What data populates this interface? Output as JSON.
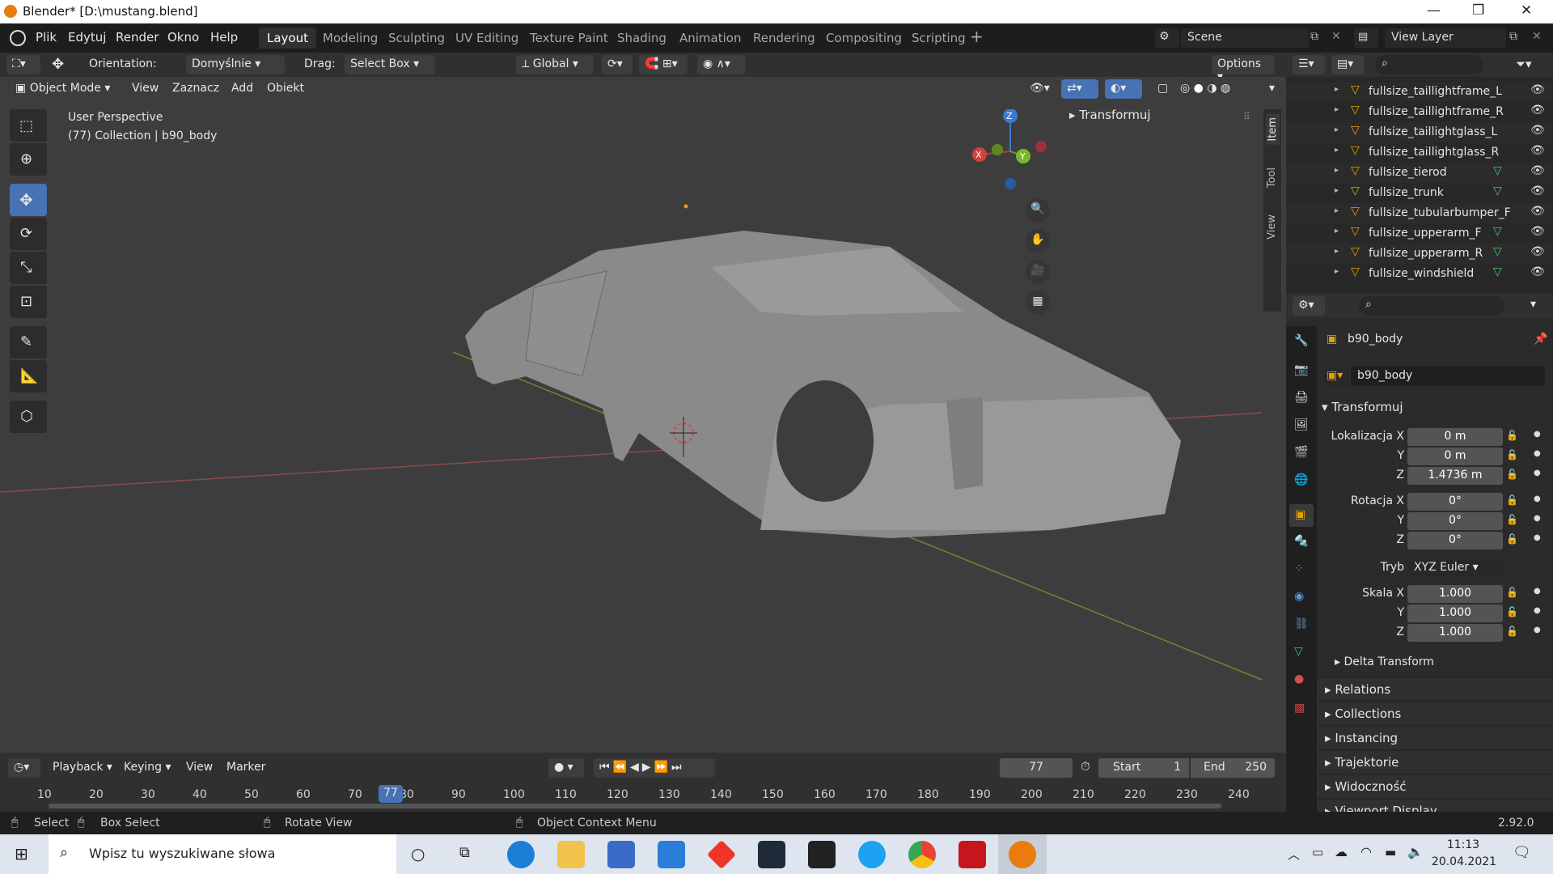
{
  "window": {
    "title": "Blender* [D:\\mustang.blend]"
  },
  "menu": [
    "Plik",
    "Edytuj",
    "Render",
    "Okno",
    "Help"
  ],
  "workspaces": [
    "Layout",
    "Modeling",
    "Sculpting",
    "UV Editing",
    "Texture Paint",
    "Shading",
    "Animation",
    "Rendering",
    "Compositing",
    "Scripting"
  ],
  "active_workspace": "Layout",
  "scene": {
    "label": "Scene",
    "view_layer": "View Layer"
  },
  "toolheader": {
    "orientation_label": "Orientation:",
    "orientation_value": "Domyślnie",
    "drag_label": "Drag:",
    "drag_value": "Select Box",
    "transform_space": "Global",
    "options": "Options"
  },
  "viewport_header": {
    "mode": "Object Mode",
    "menus": [
      "View",
      "Zaznacz",
      "Add",
      "Obiekt"
    ]
  },
  "viewport": {
    "perspective": "User Perspective",
    "collection_info": "(77) Collection | b90_body",
    "sidebar_panel": "Transformuj",
    "sidebar_tabs": [
      "Item",
      "Tool",
      "View"
    ],
    "gizmo_axes": {
      "x": "X",
      "y": "Y",
      "z": "Z"
    }
  },
  "outliner": {
    "items": [
      {
        "name": "fullsize_taillightframe_L",
        "has_mesh_icon": false
      },
      {
        "name": "fullsize_taillightframe_R",
        "has_mesh_icon": false
      },
      {
        "name": "fullsize_taillightglass_L",
        "has_mesh_icon": false
      },
      {
        "name": "fullsize_taillightglass_R",
        "has_mesh_icon": false
      },
      {
        "name": "fullsize_tierod",
        "has_mesh_icon": true
      },
      {
        "name": "fullsize_trunk",
        "has_mesh_icon": true
      },
      {
        "name": "fullsize_tubularbumper_F",
        "has_mesh_icon": false
      },
      {
        "name": "fullsize_upperarm_F",
        "has_mesh_icon": true
      },
      {
        "name": "fullsize_upperarm_R",
        "has_mesh_icon": true
      },
      {
        "name": "fullsize_windshield",
        "has_mesh_icon": true
      }
    ]
  },
  "properties": {
    "object_name": "b90_body",
    "datablock": "b90_body",
    "transform_panel": "Transformuj",
    "location_label": "Lokalizacja X",
    "location": [
      "0 m",
      "0 m",
      "1.4736 m"
    ],
    "rotation_label": "Rotacja X",
    "rotation": [
      "0°",
      "0°",
      "0°"
    ],
    "mode_label": "Tryb",
    "mode_value": "XYZ Euler",
    "scale_label": "Skala X",
    "scale": [
      "1.000",
      "1.000",
      "1.000"
    ],
    "axis_y": "Y",
    "axis_z": "Z",
    "delta": "Delta Transform",
    "panels": [
      "Relations",
      "Collections",
      "Instancing",
      "Trajektorie",
      "Widoczność",
      "Viewport Display"
    ]
  },
  "timeline": {
    "menus": [
      "Playback",
      "Keying",
      "View",
      "Marker"
    ],
    "current_frame": "77",
    "start_label": "Start",
    "start": "1",
    "end_label": "End",
    "end": "250",
    "ticks": [
      "10",
      "20",
      "30",
      "40",
      "50",
      "60",
      "70",
      "80",
      "90",
      "100",
      "110",
      "120",
      "130",
      "140",
      "150",
      "160",
      "170",
      "180",
      "190",
      "200",
      "210",
      "220",
      "230",
      "240"
    ]
  },
  "statusbar": {
    "select": "Select",
    "box_select": "Box Select",
    "rotate": "Rotate View",
    "context": "Object Context Menu",
    "version": "2.92.0"
  },
  "taskbar": {
    "search_placeholder": "Wpisz tu wyszukiwane słowa",
    "time": "11:13",
    "date": "20.04.2021"
  }
}
